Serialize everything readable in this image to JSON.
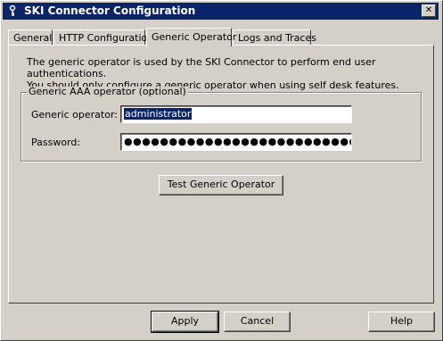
{
  "window": {
    "title": "SKI Connector Configuration",
    "close_glyph": "✕"
  },
  "tabs": [
    {
      "label": "General"
    },
    {
      "label": "HTTP Configuration"
    },
    {
      "label": "Generic Operator"
    },
    {
      "label": "Logs and Traces"
    }
  ],
  "active_tab": "Generic Operator",
  "intro": {
    "line1": "The generic operator is used by the SKI Connector to perform end user authentications.",
    "line2": "You should only configure a generic operator when using self desk features."
  },
  "group": {
    "legend": "Generic AAA operator (optional)",
    "operator_label": "Generic operator:",
    "operator_value": "administrator",
    "password_label": "Password:",
    "password_value": "●●●●●●●●●●●●●●●●●●●●●●●●●●●●●●●"
  },
  "buttons": {
    "test": "Test Generic Operator",
    "apply": "Apply",
    "cancel": "Cancel",
    "help": "Help"
  },
  "colors": {
    "titlebar": "#0a246a",
    "face": "#d4d0c8",
    "selection": "#0a246a"
  }
}
